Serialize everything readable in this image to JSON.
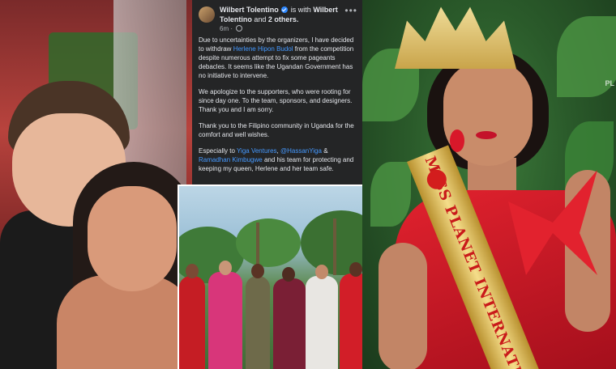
{
  "post": {
    "author": "Wilbert Tolentino",
    "is_with_prefix": "is with",
    "tagged_person": "Wilbert Tolentino",
    "others_connector": "and",
    "others_count": "2 others.",
    "time": "6m",
    "more_icon": "more-horizontal-icon",
    "paragraphs": {
      "p1_before": "Due to uncertainties by the organizers, I have decided to withdraw",
      "p1_link": "Herlene Hipon Budol",
      "p1_after": "from the competition despite numerous attempt to fix some pageants debacles. It seems like the Ugandan Government has no initiative to intervene.",
      "p2": "We apologize to the supporters, who were rooting for since day one. To the team, sponsors, and designers. Thank you and I am sorry.",
      "p3": "Thank you to the Filipino community in Uganda for the comfort and well wishes.",
      "p4_before": "Especially to",
      "p4_link1": "Yiga Ventures",
      "p4_sep1": ",",
      "p4_link2": "@HassanYiga",
      "p4_sep2": "&",
      "p4_link3": "Ramadhan Kimbugwe",
      "p4_after": "and his team for protecting and keeping my queen, Herlene and her team safe."
    }
  },
  "right_photo": {
    "sash_text": "MISS PLANET INTERNATI",
    "watermark": "PL"
  },
  "colors": {
    "post_bg": "#242526",
    "link": "#4599ff",
    "dress_red": "#e2222e",
    "sash_gold": "#f5dd8a"
  }
}
